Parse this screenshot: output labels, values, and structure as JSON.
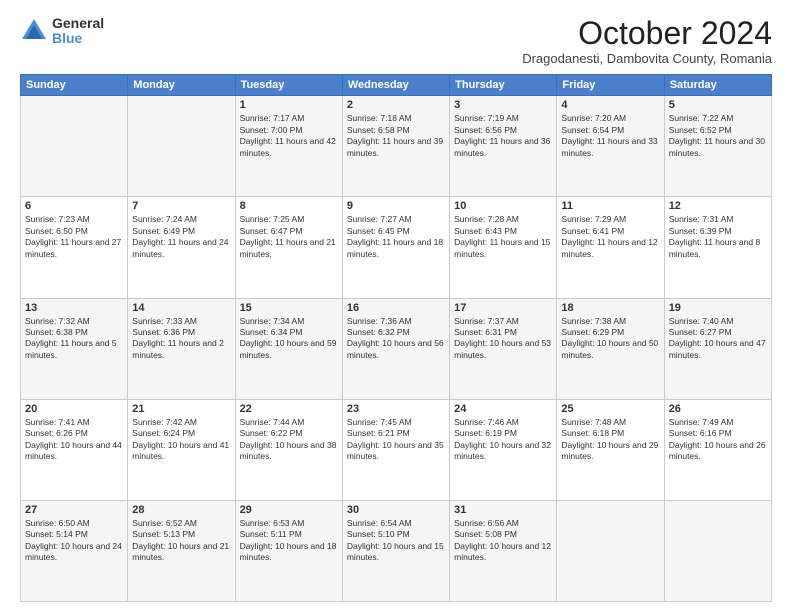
{
  "logo": {
    "general": "General",
    "blue": "Blue"
  },
  "header": {
    "month": "October 2024",
    "location": "Dragodanesti, Dambovita County, Romania"
  },
  "days_of_week": [
    "Sunday",
    "Monday",
    "Tuesday",
    "Wednesday",
    "Thursday",
    "Friday",
    "Saturday"
  ],
  "weeks": [
    [
      {
        "day": "",
        "info": ""
      },
      {
        "day": "",
        "info": ""
      },
      {
        "day": "1",
        "info": "Sunrise: 7:17 AM\nSunset: 7:00 PM\nDaylight: 11 hours and 42 minutes."
      },
      {
        "day": "2",
        "info": "Sunrise: 7:18 AM\nSunset: 6:58 PM\nDaylight: 11 hours and 39 minutes."
      },
      {
        "day": "3",
        "info": "Sunrise: 7:19 AM\nSunset: 6:56 PM\nDaylight: 11 hours and 36 minutes."
      },
      {
        "day": "4",
        "info": "Sunrise: 7:20 AM\nSunset: 6:54 PM\nDaylight: 11 hours and 33 minutes."
      },
      {
        "day": "5",
        "info": "Sunrise: 7:22 AM\nSunset: 6:52 PM\nDaylight: 11 hours and 30 minutes."
      }
    ],
    [
      {
        "day": "6",
        "info": "Sunrise: 7:23 AM\nSunset: 6:50 PM\nDaylight: 11 hours and 27 minutes."
      },
      {
        "day": "7",
        "info": "Sunrise: 7:24 AM\nSunset: 6:49 PM\nDaylight: 11 hours and 24 minutes."
      },
      {
        "day": "8",
        "info": "Sunrise: 7:25 AM\nSunset: 6:47 PM\nDaylight: 11 hours and 21 minutes."
      },
      {
        "day": "9",
        "info": "Sunrise: 7:27 AM\nSunset: 6:45 PM\nDaylight: 11 hours and 18 minutes."
      },
      {
        "day": "10",
        "info": "Sunrise: 7:28 AM\nSunset: 6:43 PM\nDaylight: 11 hours and 15 minutes."
      },
      {
        "day": "11",
        "info": "Sunrise: 7:29 AM\nSunset: 6:41 PM\nDaylight: 11 hours and 12 minutes."
      },
      {
        "day": "12",
        "info": "Sunrise: 7:31 AM\nSunset: 6:39 PM\nDaylight: 11 hours and 8 minutes."
      }
    ],
    [
      {
        "day": "13",
        "info": "Sunrise: 7:32 AM\nSunset: 6:38 PM\nDaylight: 11 hours and 5 minutes."
      },
      {
        "day": "14",
        "info": "Sunrise: 7:33 AM\nSunset: 6:36 PM\nDaylight: 11 hours and 2 minutes."
      },
      {
        "day": "15",
        "info": "Sunrise: 7:34 AM\nSunset: 6:34 PM\nDaylight: 10 hours and 59 minutes."
      },
      {
        "day": "16",
        "info": "Sunrise: 7:36 AM\nSunset: 6:32 PM\nDaylight: 10 hours and 56 minutes."
      },
      {
        "day": "17",
        "info": "Sunrise: 7:37 AM\nSunset: 6:31 PM\nDaylight: 10 hours and 53 minutes."
      },
      {
        "day": "18",
        "info": "Sunrise: 7:38 AM\nSunset: 6:29 PM\nDaylight: 10 hours and 50 minutes."
      },
      {
        "day": "19",
        "info": "Sunrise: 7:40 AM\nSunset: 6:27 PM\nDaylight: 10 hours and 47 minutes."
      }
    ],
    [
      {
        "day": "20",
        "info": "Sunrise: 7:41 AM\nSunset: 6:26 PM\nDaylight: 10 hours and 44 minutes."
      },
      {
        "day": "21",
        "info": "Sunrise: 7:42 AM\nSunset: 6:24 PM\nDaylight: 10 hours and 41 minutes."
      },
      {
        "day": "22",
        "info": "Sunrise: 7:44 AM\nSunset: 6:22 PM\nDaylight: 10 hours and 38 minutes."
      },
      {
        "day": "23",
        "info": "Sunrise: 7:45 AM\nSunset: 6:21 PM\nDaylight: 10 hours and 35 minutes."
      },
      {
        "day": "24",
        "info": "Sunrise: 7:46 AM\nSunset: 6:19 PM\nDaylight: 10 hours and 32 minutes."
      },
      {
        "day": "25",
        "info": "Sunrise: 7:48 AM\nSunset: 6:18 PM\nDaylight: 10 hours and 29 minutes."
      },
      {
        "day": "26",
        "info": "Sunrise: 7:49 AM\nSunset: 6:16 PM\nDaylight: 10 hours and 26 minutes."
      }
    ],
    [
      {
        "day": "27",
        "info": "Sunrise: 6:50 AM\nSunset: 5:14 PM\nDaylight: 10 hours and 24 minutes."
      },
      {
        "day": "28",
        "info": "Sunrise: 6:52 AM\nSunset: 5:13 PM\nDaylight: 10 hours and 21 minutes."
      },
      {
        "day": "29",
        "info": "Sunrise: 6:53 AM\nSunset: 5:11 PM\nDaylight: 10 hours and 18 minutes."
      },
      {
        "day": "30",
        "info": "Sunrise: 6:54 AM\nSunset: 5:10 PM\nDaylight: 10 hours and 15 minutes."
      },
      {
        "day": "31",
        "info": "Sunrise: 6:56 AM\nSunset: 5:08 PM\nDaylight: 10 hours and 12 minutes."
      },
      {
        "day": "",
        "info": ""
      },
      {
        "day": "",
        "info": ""
      }
    ]
  ]
}
